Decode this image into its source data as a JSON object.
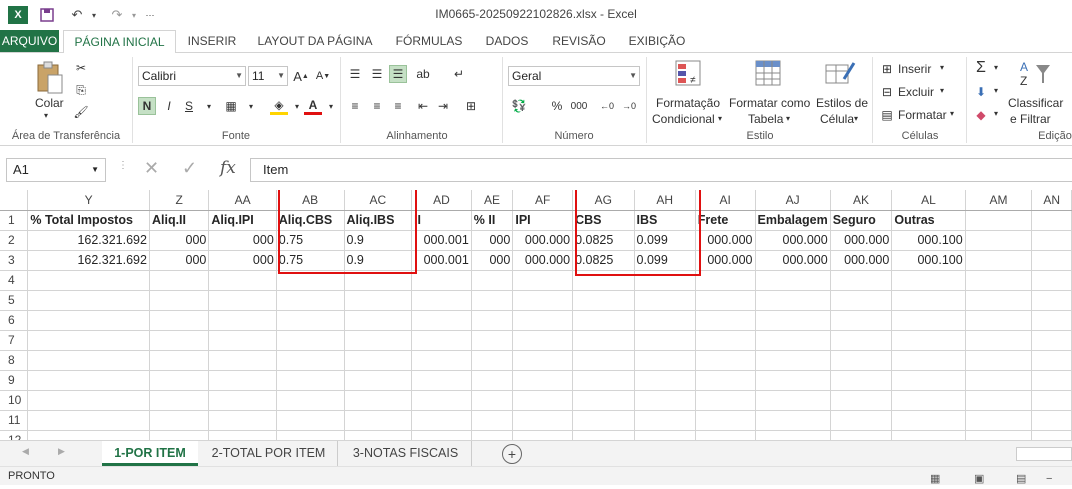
{
  "window": {
    "title": "IM0665-20250922102826.xlsx - Excel"
  },
  "qat": {
    "save_icon": "save-icon",
    "undo_icon": "undo-icon",
    "redo_icon": "redo-icon"
  },
  "tabs": [
    "ARQUIVO",
    "PÁGINA INICIAL",
    "INSERIR",
    "LAYOUT DA PÁGINA",
    "FÓRMULAS",
    "DADOS",
    "REVISÃO",
    "EXIBIÇÃO"
  ],
  "ribbon": {
    "clipboard": {
      "paste_label": "Colar",
      "group": "Área de Transferência"
    },
    "font": {
      "name": "Calibri",
      "size": "11",
      "bold": "N",
      "italic": "I",
      "underline": "S",
      "group": "Fonte"
    },
    "alignment": {
      "group": "Alinhamento"
    },
    "number": {
      "format": "Geral",
      "group": "Número"
    },
    "styles": {
      "cond_format_1": "Formatação",
      "cond_format_2": "Condicional",
      "format_table_1": "Formatar como",
      "format_table_2": "Tabela",
      "cell_styles_1": "Estilos de",
      "cell_styles_2": "Célula",
      "group": "Estilo"
    },
    "cells": {
      "insert": "Inserir",
      "delete": "Excluir",
      "format": "Formatar",
      "group": "Células"
    },
    "editing": {
      "sort_1": "Classificar",
      "sort_2": "e Filtrar",
      "group": "Edição"
    }
  },
  "formula_bar": {
    "name_box": "A1",
    "fx": "fx",
    "content": "Item"
  },
  "sheet": {
    "columns": [
      "Y",
      "Z",
      "AA",
      "AB",
      "AC",
      "AD",
      "AE",
      "AF",
      "AG",
      "AH",
      "AI",
      "AJ",
      "AK",
      "AL",
      "AM",
      "AN"
    ],
    "rows": [
      {
        "n": "1",
        "cells": [
          "% Total Impostos",
          "Aliq.II",
          "Aliq.IPI",
          "Aliq.CBS",
          "Aliq.IBS",
          "II",
          "% II",
          "IPI",
          "CBS",
          "IBS",
          "Frete",
          "Embalagem",
          "Seguro",
          "Outras",
          "",
          ""
        ]
      },
      {
        "n": "2",
        "cells": [
          "162.321.692",
          "000",
          "000",
          "0.75",
          "0.9",
          "000.001",
          "000",
          "000.000",
          "0.0825",
          "0.099",
          "000.000",
          "000.000",
          "000.000",
          "000.100",
          "",
          ""
        ]
      },
      {
        "n": "3",
        "cells": [
          "162.321.692",
          "000",
          "000",
          "0.75",
          "0.9",
          "000.001",
          "000",
          "000.000",
          "0.0825",
          "0.099",
          "000.000",
          "000.000",
          "000.000",
          "000.100",
          "",
          ""
        ]
      },
      {
        "n": "4",
        "cells": []
      },
      {
        "n": "5",
        "cells": []
      },
      {
        "n": "6",
        "cells": []
      },
      {
        "n": "7",
        "cells": []
      },
      {
        "n": "8",
        "cells": []
      },
      {
        "n": "9",
        "cells": []
      },
      {
        "n": "10",
        "cells": []
      },
      {
        "n": "11",
        "cells": []
      },
      {
        "n": "12",
        "cells": []
      }
    ]
  },
  "sheet_tabs": [
    "1-POR ITEM",
    "2-TOTAL POR ITEM",
    "3-NOTAS FISCAIS"
  ],
  "status": {
    "text": "PRONTO"
  },
  "colors": {
    "accent": "#217346",
    "highlight": "#e01010"
  }
}
